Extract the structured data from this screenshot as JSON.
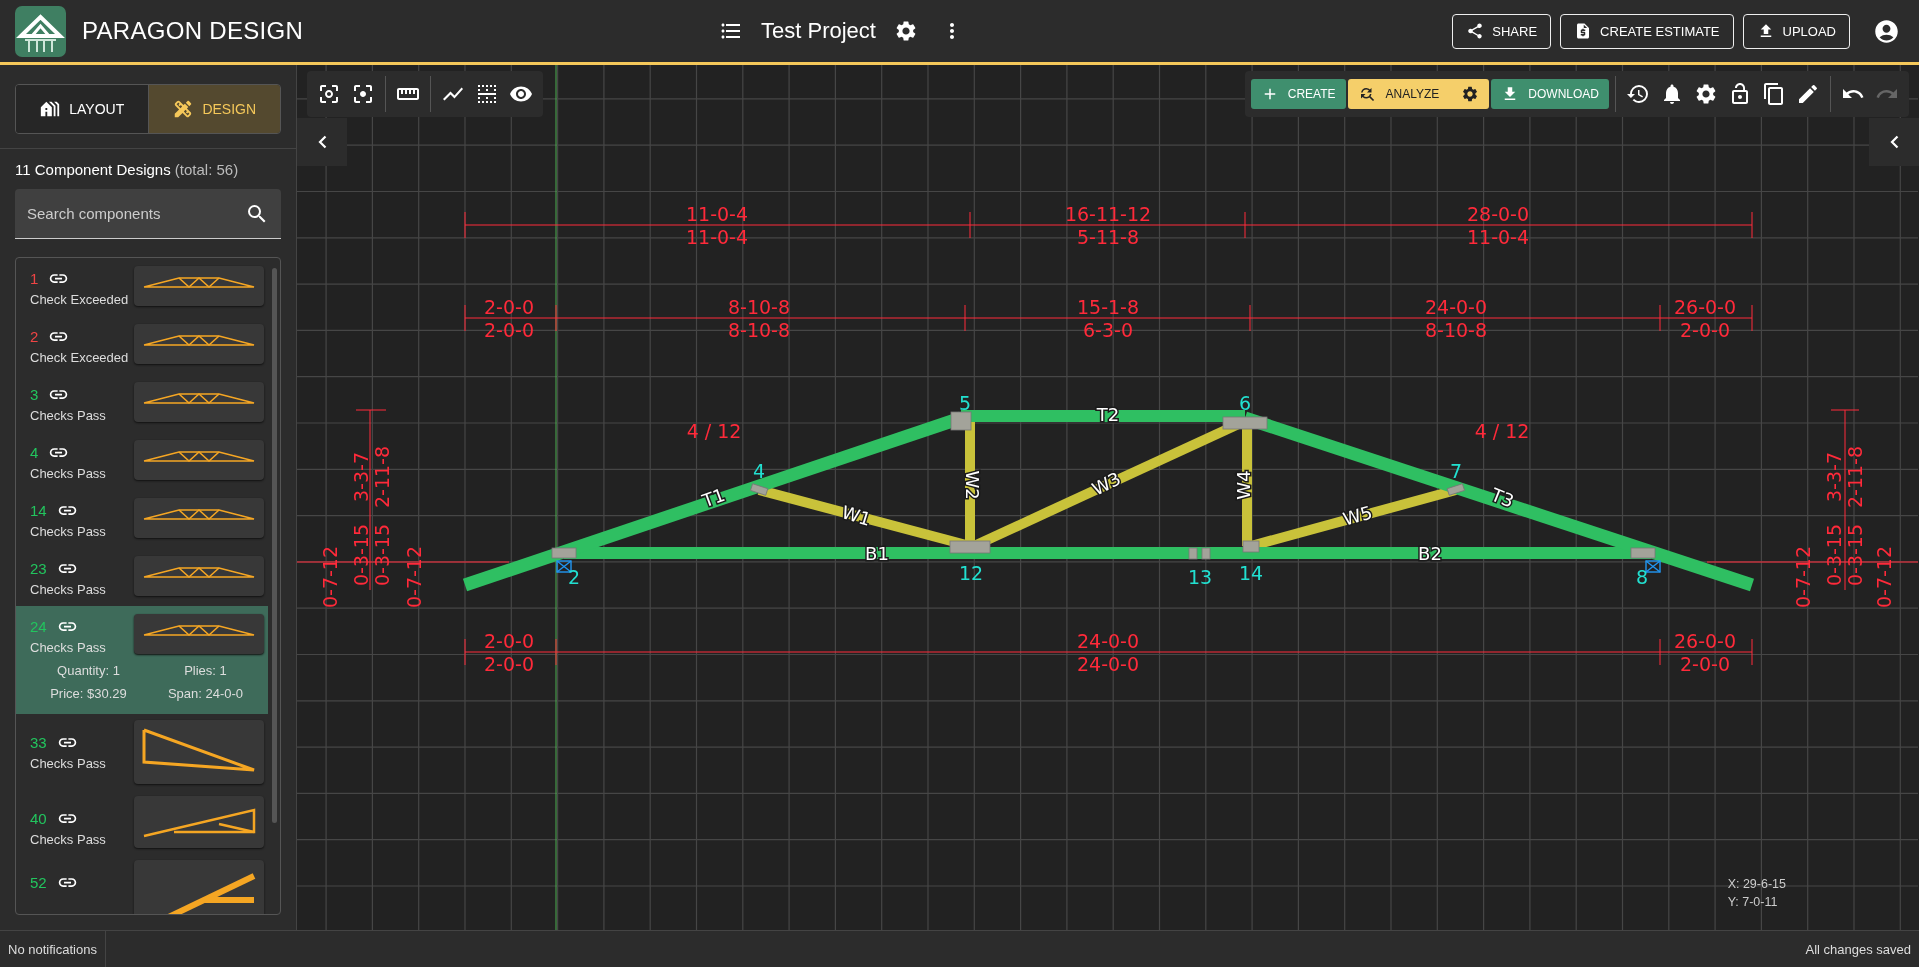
{
  "app": {
    "title": "PARAGON DESIGN"
  },
  "project": {
    "name": "Test Project"
  },
  "header_buttons": [
    {
      "label": "SHARE",
      "kind": "share"
    },
    {
      "label": "CREATE ESTIMATE",
      "kind": "estimate"
    },
    {
      "label": "UPLOAD",
      "kind": "upload"
    }
  ],
  "sidebar": {
    "tabs": [
      {
        "label": "LAYOUT",
        "kind": "layout",
        "selected": false
      },
      {
        "label": "DESIGN",
        "kind": "design",
        "selected": true
      }
    ],
    "heading": "11 Component Designs",
    "heading_note": "(total: 56)",
    "search": {
      "placeholder": "Search components"
    },
    "items": [
      {
        "number": "1",
        "color": "#ef4444",
        "status": "Check Exceeded",
        "kind": "gable",
        "selected": false
      },
      {
        "number": "2",
        "color": "#ef4444",
        "status": "Check Exceeded",
        "kind": "gable",
        "selected": false
      },
      {
        "number": "3",
        "color": "#22c55e",
        "status": "Checks Pass",
        "kind": "gable",
        "selected": false
      },
      {
        "number": "4",
        "color": "#22c55e",
        "status": "Checks Pass",
        "kind": "gable",
        "selected": false
      },
      {
        "number": "14",
        "color": "#22c55e",
        "status": "Checks Pass",
        "kind": "gable",
        "selected": false
      },
      {
        "number": "23",
        "color": "#22c55e",
        "status": "Checks Pass",
        "kind": "gable",
        "selected": false
      },
      {
        "number": "24",
        "color": "#22c55e",
        "status": "Checks Pass",
        "kind": "gable",
        "selected": true,
        "details": [
          "Quantity: 1",
          "Plies: 1",
          "Price: $30.29",
          "Span: 24-0-0"
        ]
      },
      {
        "number": "33",
        "color": "#22c55e",
        "status": "Checks Pass",
        "kind": "mono-down",
        "selected": false
      },
      {
        "number": "40",
        "color": "#22c55e",
        "status": "Checks Pass",
        "kind": "mono-up",
        "selected": false
      },
      {
        "number": "52",
        "color": "#22c55e",
        "kind": "steep",
        "selected": false
      }
    ]
  },
  "toolbar": {
    "create": "CREATE",
    "analyze": "ANALYZE",
    "download": "DOWNLOAD",
    "history_tools": [
      {
        "kind": "undo",
        "disabled": false
      },
      {
        "kind": "redo",
        "disabled": true
      }
    ]
  },
  "canvas": {
    "span_dims": [
      {
        "upper": "11-0-4",
        "lower": "11-0-4"
      },
      {
        "upper": "16-11-12",
        "lower": "5-11-8"
      },
      {
        "upper": "28-0-0",
        "lower": "11-0-4"
      }
    ],
    "panel_dims": [
      {
        "upper": "2-0-0",
        "lower": "2-0-0"
      },
      {
        "upper": "8-10-8",
        "lower": "8-10-8"
      },
      {
        "upper": "15-1-8",
        "lower": "6-3-0"
      },
      {
        "upper": "24-0-0",
        "lower": "8-10-8"
      },
      {
        "upper": "26-0-0",
        "lower": "2-0-0"
      }
    ],
    "bottom_dims": [
      {
        "upper": "2-0-0",
        "lower": "2-0-0"
      },
      {
        "upper": "24-0-0",
        "lower": "24-0-0"
      },
      {
        "upper": "26-0-0",
        "lower": "2-0-0"
      }
    ],
    "pitches": [
      "4 / 12",
      "4 / 12"
    ],
    "members": [
      "T1",
      "T2",
      "T3",
      "B1",
      "B2",
      "W1",
      "W2",
      "W3",
      "W4",
      "W5"
    ],
    "joints": [
      "2",
      "4",
      "5",
      "12",
      "6",
      "13",
      "14",
      "7",
      "8"
    ],
    "left_heights": [
      "0-7-12",
      "3-3-7",
      "0-3-15",
      "2-11-8",
      "0-3-15",
      "0-7-12"
    ],
    "right_heights": [
      "0-7-12",
      "3-3-7",
      "0-3-15",
      "2-11-8",
      "0-3-15",
      "0-7-12"
    ],
    "cursor": {
      "x": "X: 29-6-15",
      "y": "Y: 7-0-11"
    }
  },
  "status_bar": {
    "left": "No notifications",
    "right": "All changes saved"
  }
}
